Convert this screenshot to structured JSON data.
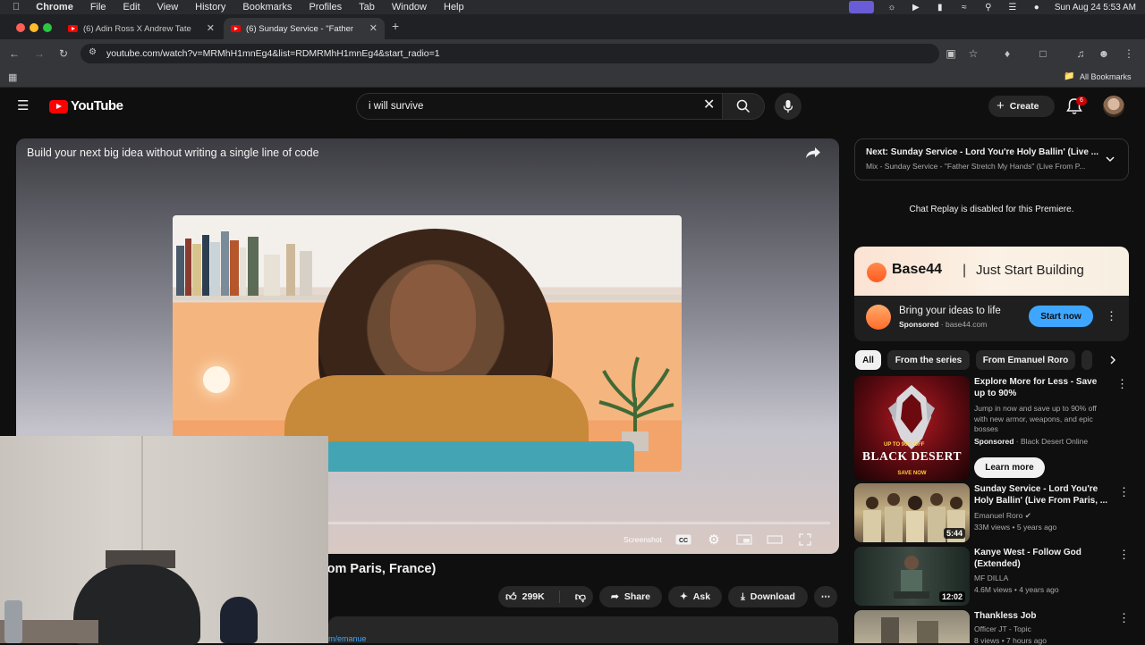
{
  "menubar": {
    "app": "Chrome",
    "items": [
      "File",
      "Edit",
      "View",
      "History",
      "Bookmarks",
      "Profiles",
      "Tab",
      "Window",
      "Help"
    ],
    "clock": "Sun Aug 24  5:53 AM"
  },
  "tabs": [
    {
      "title": "(6) Adin Ross X Andrew Tate",
      "active": false
    },
    {
      "title": "(6) Sunday Service - \"Father",
      "active": true
    }
  ],
  "omnibox": {
    "url": "youtube.com/watch?v=MRMhH1mnEg4&list=RDMRMhH1mnEg4&start_radio=1"
  },
  "bookmarks": {
    "all_label": "All Bookmarks"
  },
  "youtube": {
    "logo_text": "YouTube",
    "search_query": "i will survive",
    "create_label": "Create",
    "notif_count": "6"
  },
  "player": {
    "ad_title": "Build your next big idea without writing a single line of code",
    "screenshot_label": "Screenshot",
    "progress_fraction": 0.0
  },
  "video": {
    "title_visible": "rom Paris, France)",
    "likes": "299K",
    "share_label": "Share",
    "ask_label": "Ask",
    "download_label": "Download",
    "desc_link": "m/emanue"
  },
  "up_next": {
    "title": "Next: Sunday Service - Lord You're Holy Ballin' (Live ...",
    "subtitle": "Mix - Sunday Service - \"Father Stretch My Hands\" (Live From P..."
  },
  "chat": {
    "disabled_text": "Chat Replay is disabled for this Premiere."
  },
  "sponsor": {
    "brand": "Base44",
    "separator": "|",
    "tagline": "Just Start Building",
    "headline": "Bring your ideas to life",
    "sponsored": "Sponsored",
    "domain": "base44.com",
    "cta": "Start now"
  },
  "chips": [
    "All",
    "From the series",
    "From Emanuel Roro"
  ],
  "related": [
    {
      "title": "Explore More for Less - Save up to 90%",
      "desc": "Jump in now and save up to 90% off with new armor, weapons, and epic bosses",
      "sponsored": "Sponsored",
      "channel": "Black Desert Online",
      "cta": "Learn more",
      "thumb_text": "BLACK DESERT",
      "thumb_small": "UP TO 90% OFF",
      "thumb_save": "SAVE NOW"
    },
    {
      "title": "Sunday Service - Lord You're Holy Ballin' (Live From Paris, ...",
      "channel": "Emanuel Roro",
      "meta": "33M views • 5 years ago",
      "duration": "5:44"
    },
    {
      "title": "Kanye West - Follow God (Extended)",
      "channel": "MF DILLA",
      "meta": "4.6M views • 4 years ago",
      "duration": "12:02"
    },
    {
      "title": "Thankless Job",
      "channel": "Officer JT - Topic",
      "meta": "8 views • 7 hours ago"
    }
  ],
  "colors": {
    "yt_red": "#ff0000",
    "link_blue": "#3ea6ff",
    "bg": "#0f0f0f"
  }
}
